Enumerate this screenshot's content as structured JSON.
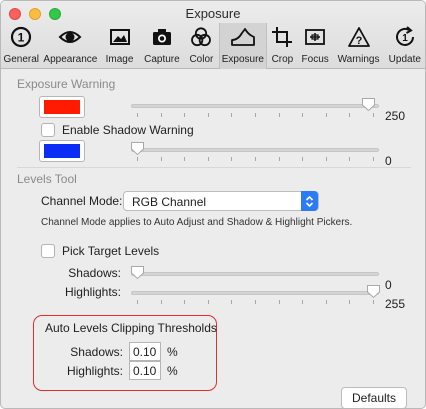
{
  "window": {
    "title": "Exposure"
  },
  "toolbar": {
    "items": [
      {
        "label": "General",
        "icon": "info-circle-icon"
      },
      {
        "label": "Appearance",
        "icon": "eye-icon"
      },
      {
        "label": "Image",
        "icon": "picture-icon"
      },
      {
        "label": "Capture",
        "icon": "camera-icon"
      },
      {
        "label": "Color",
        "icon": "color-circles-icon"
      },
      {
        "label": "Exposure",
        "icon": "exposure-curve-icon",
        "selected": true
      },
      {
        "label": "Crop",
        "icon": "crop-icon"
      },
      {
        "label": "Focus",
        "icon": "focus-icon"
      },
      {
        "label": "Warnings",
        "icon": "warning-triangle-icon"
      },
      {
        "label": "Update",
        "icon": "update-icon"
      }
    ]
  },
  "exposure_warning": {
    "heading": "Exposure Warning",
    "highlight_color": "#ff1a00",
    "highlight_value": "250",
    "highlight_level": 250,
    "shadow_checkbox_label": "Enable Shadow Warning",
    "shadow_checked": false,
    "shadow_color": "#0a2cf5",
    "shadow_value": "0",
    "shadow_level": 0
  },
  "levels_tool": {
    "heading": "Levels Tool",
    "channel_mode_label": "Channel Mode:",
    "channel_mode_value": "RGB Channel",
    "channel_note": "Channel Mode applies to Auto Adjust and Shadow & Highlight Pickers.",
    "pick_target_label": "Pick Target Levels",
    "pick_target_checked": false,
    "shadows_label": "Shadows:",
    "shadows_value": "0",
    "shadows_level": 0,
    "highlights_label": "Highlights:",
    "highlights_value": "255",
    "highlights_level": 255
  },
  "clipping": {
    "heading": "Auto Levels Clipping Thresholds",
    "shadows_label": "Shadows:",
    "shadows_value": "0.10",
    "highlights_label": "Highlights:",
    "highlights_value": "0.10",
    "unit": "%"
  },
  "footer": {
    "defaults_label": "Defaults"
  },
  "colors": {
    "accent": "#2b7bf5",
    "highlight_box": "#e12f2f"
  }
}
